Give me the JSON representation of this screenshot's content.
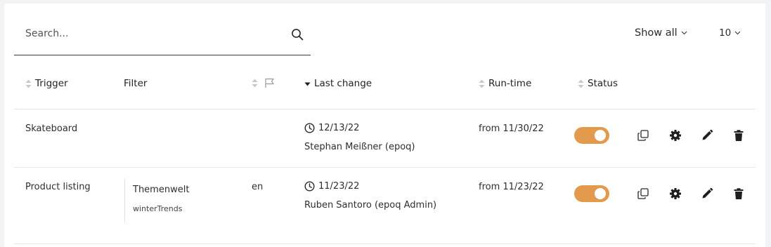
{
  "search": {
    "placeholder": "Search...",
    "value": ""
  },
  "toolbar": {
    "show_all_label": "Show all",
    "page_size": "10"
  },
  "columns": {
    "trigger": "Trigger",
    "filter": "Filter",
    "last_change": "Last change",
    "run_time": "Run-time",
    "status": "Status"
  },
  "rows": [
    {
      "trigger": "Skateboard",
      "filter_name": "",
      "filter_sub": "",
      "language": "",
      "date": "12/13/22",
      "user": "Stephan Meißner (epoq)",
      "run_time": "from 11/30/22",
      "status_on": true
    },
    {
      "trigger": "Product listing",
      "filter_name": "Themenwelt",
      "filter_sub": "winterTrends",
      "language": "en",
      "date": "11/23/22",
      "user": "Ruben Santoro (epoq Admin)",
      "run_time": "from 11/23/22",
      "status_on": true
    }
  ],
  "icons": {
    "search": "search-icon",
    "sort": "sort-icon",
    "sort_desc": "caret-down-icon",
    "flag": "flag-icon",
    "clock": "clock-icon",
    "copy": "copy-icon",
    "settings": "gear-icon",
    "edit": "pencil-icon",
    "delete": "trash-icon"
  },
  "colors": {
    "toggle_on": "#e49a4c",
    "sort_icon": "#c8c8c8",
    "divider": "#e6e7ea"
  }
}
